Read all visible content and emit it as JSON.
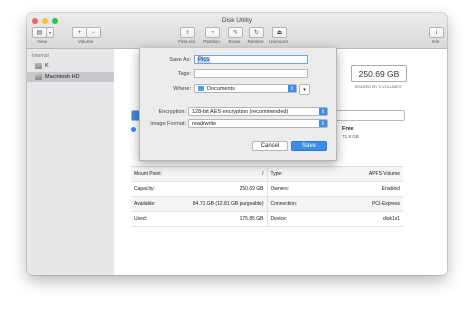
{
  "window": {
    "title": "Disk Utility"
  },
  "toolbar": {
    "view_label": "View",
    "volume_label": "Volume",
    "plus": "+",
    "minus": "−",
    "first_aid": "First Aid",
    "partition": "Partition",
    "erase": "Erase",
    "restore": "Restore",
    "unmount": "Unmount",
    "info": "Info",
    "info_icon": "i"
  },
  "sidebar": {
    "header": "Internal",
    "items": [
      {
        "label": "K",
        "selected": false
      },
      {
        "label": "Macintosh HD",
        "selected": true
      }
    ]
  },
  "summary": {
    "size": "250.69 GB",
    "shared": "SHARED BY 5 VOLUMES",
    "free_label": "Free",
    "free_value": "71.9 GB",
    "used_fraction": 0.7
  },
  "info_table": [
    {
      "k1": "Mount Point:",
      "v1": "/",
      "k2": "Type:",
      "v2": "APFS Volume"
    },
    {
      "k1": "Capacity:",
      "v1": "250.69 GB",
      "k2": "Owners:",
      "v2": "Enabled"
    },
    {
      "k1": "Available:",
      "v1": "84.71 GB (12.81 GB purgeable)",
      "k2": "Connection:",
      "v2": "PCI-Express"
    },
    {
      "k1": "Used:",
      "v1": "175.85 GB",
      "k2": "Device:",
      "v2": "disk1s1"
    }
  ],
  "save_dialog": {
    "save_as_label": "Save As:",
    "save_as_value": "Pics",
    "tags_label": "Tags:",
    "tags_value": "",
    "where_label": "Where:",
    "where_value": "Documents",
    "encryption_label": "Encryption:",
    "encryption_value": "128-bit AES encryption (recommended)",
    "format_label": "Image Format:",
    "format_value": "read/write",
    "cancel": "Cancel",
    "save": "Save"
  },
  "colors": {
    "accent": "#3a8ee6",
    "close": "#fc5f57",
    "minimize": "#fdbc2e",
    "zoom": "#28c840"
  }
}
